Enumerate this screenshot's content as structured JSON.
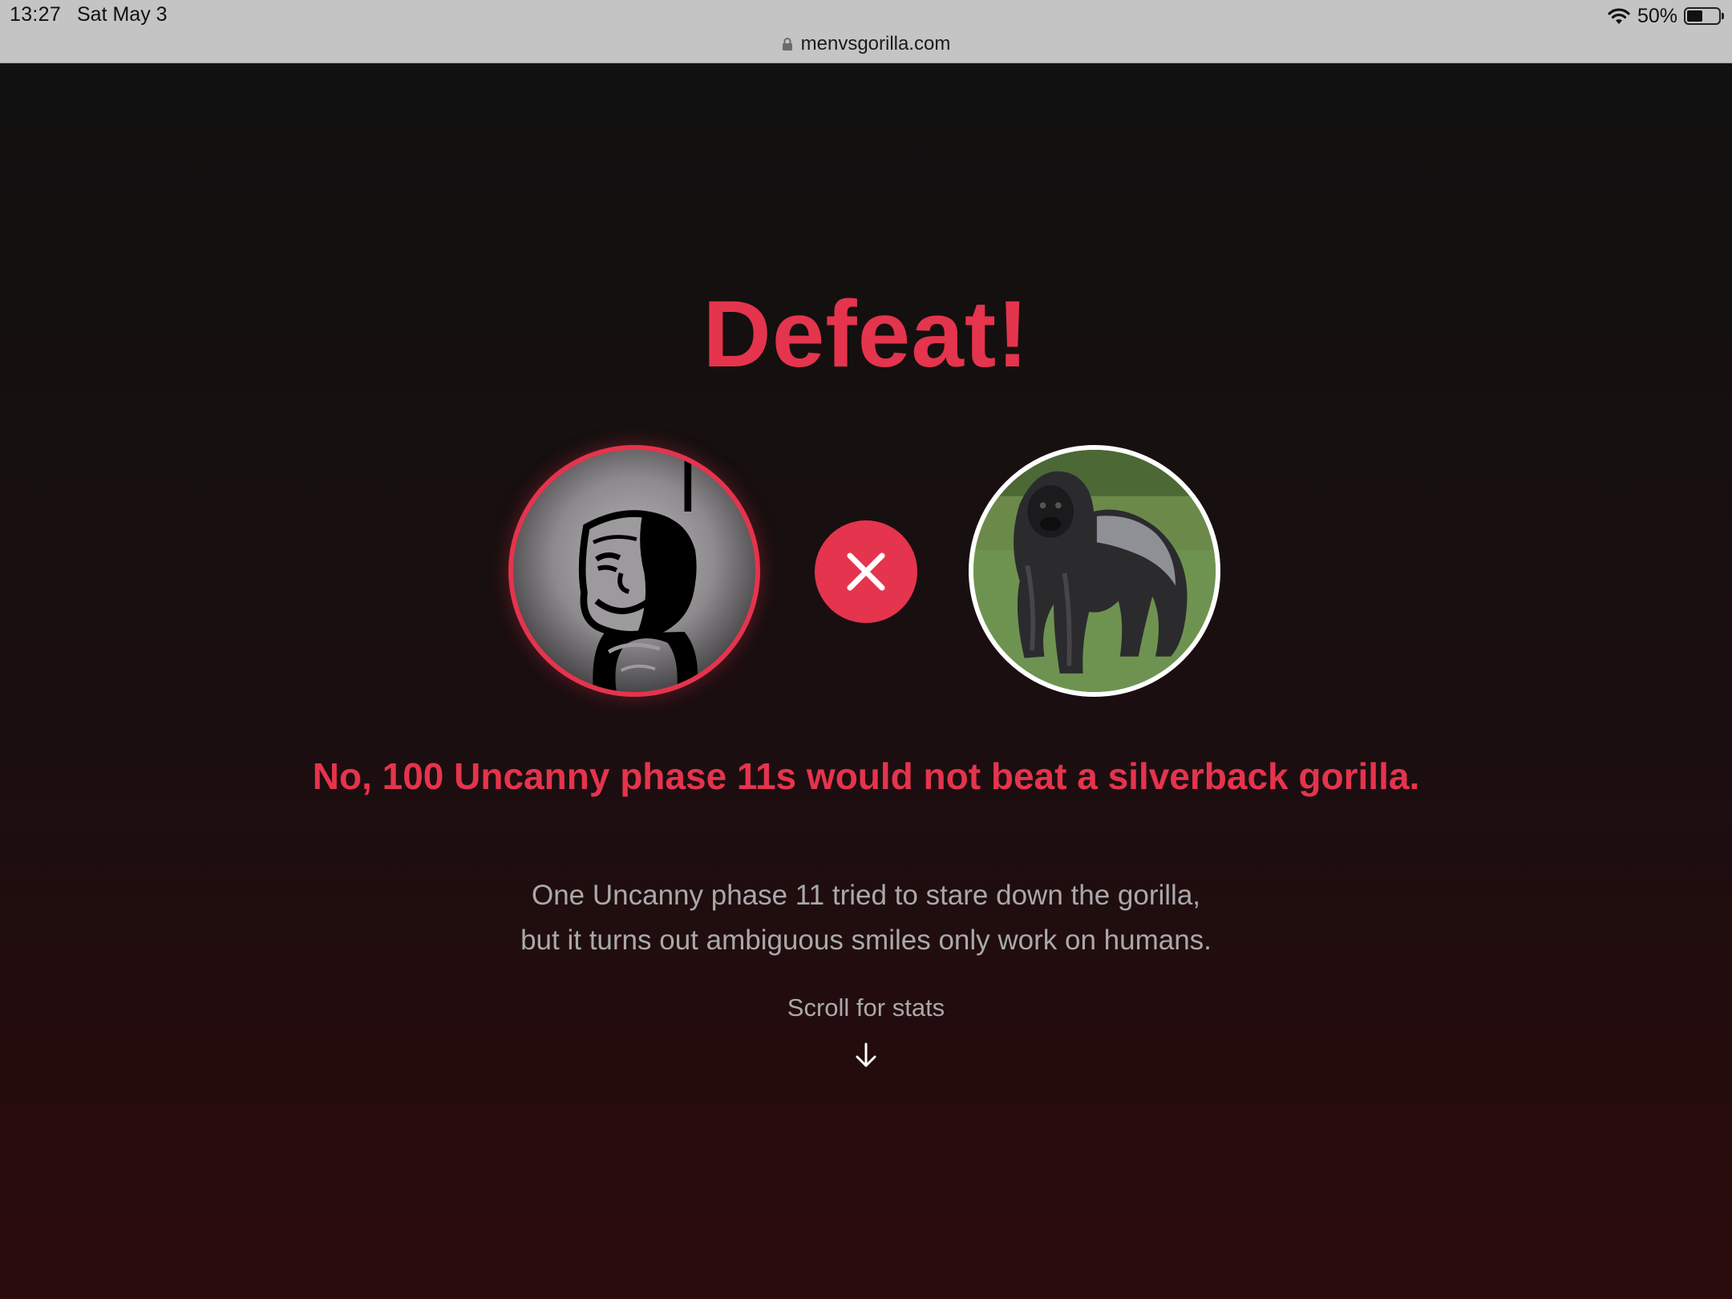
{
  "status_bar": {
    "time": "13:27",
    "date": "Sat May 3",
    "battery_text": "50%",
    "battery_level": 0.5,
    "wifi_icon": "wifi-icon"
  },
  "browser": {
    "url": "menvsgorilla.com",
    "lock_icon": "lock-icon"
  },
  "result": {
    "title": "Defeat!",
    "headline": "No, 100 Uncanny phase 11s would not beat a silverback gorilla.",
    "description_lines": [
      "One Uncanny phase 11 tried to stare down the gorilla,",
      "but it turns out ambiguous smiles only work on humans."
    ],
    "scroll_label": "Scroll for stats"
  },
  "icons": {
    "vs_icon": "close-x-icon",
    "scroll_icon": "arrow-down-icon"
  },
  "colors": {
    "accent": "#e5344d",
    "status_bar": "#c4c4c4",
    "muted_text": "#a9a9ab"
  }
}
